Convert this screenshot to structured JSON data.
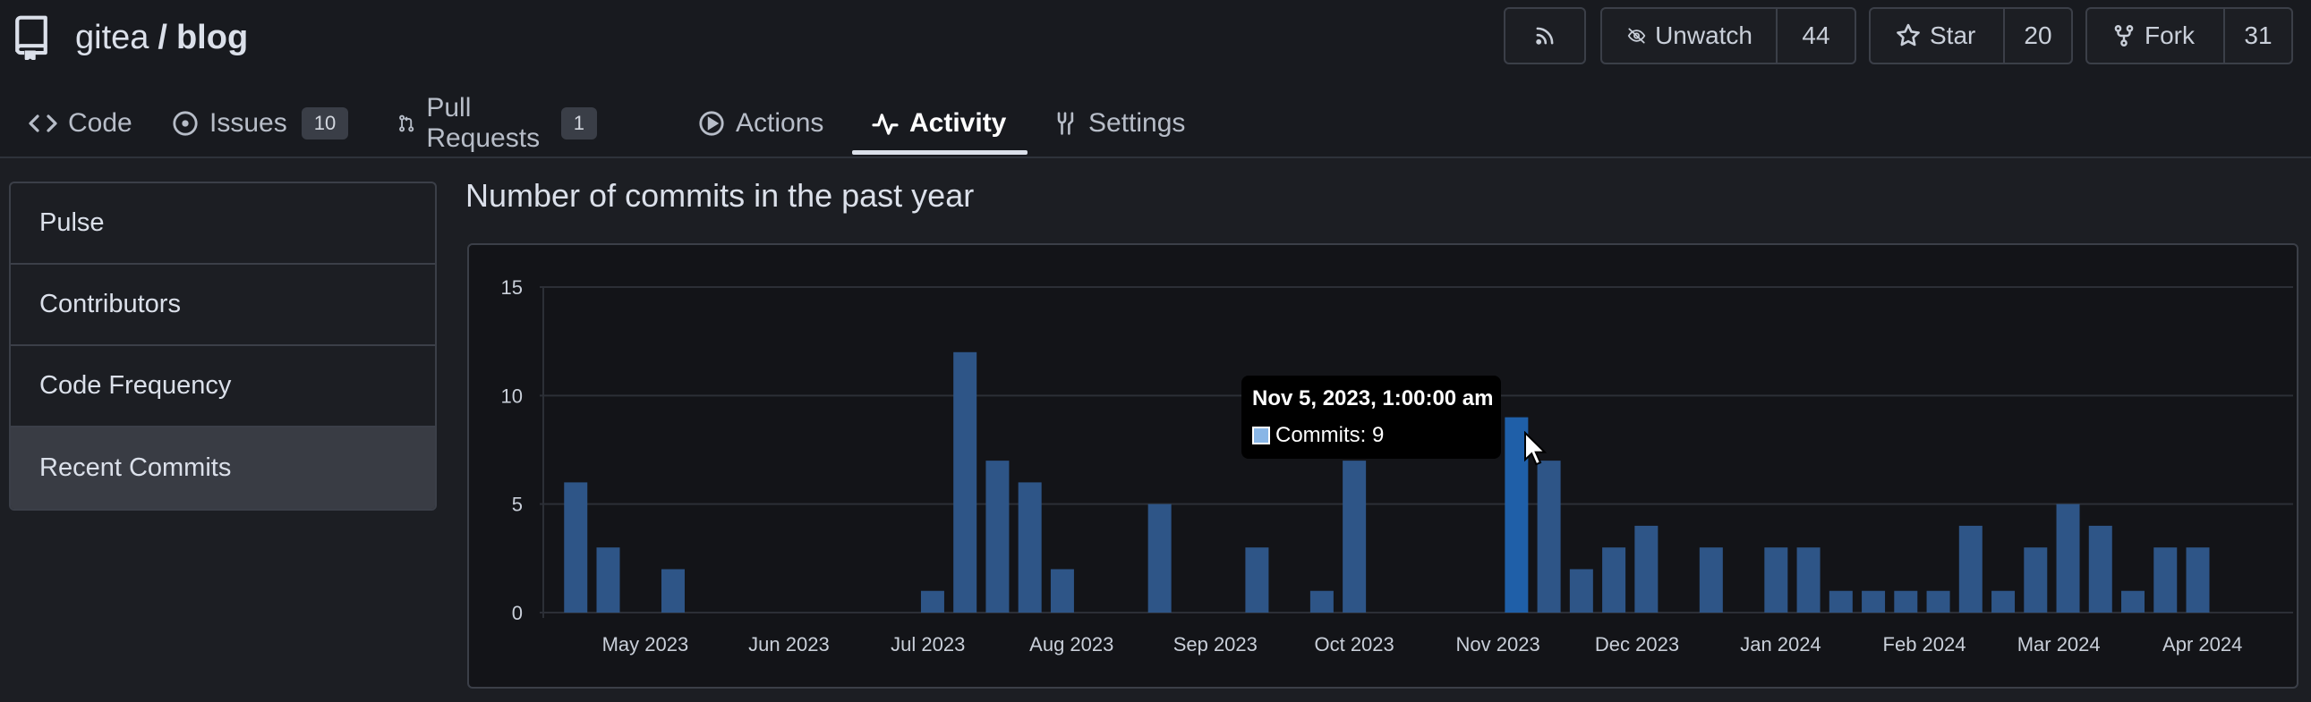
{
  "repo": {
    "owner": "gitea",
    "separator": "/",
    "name": "blog"
  },
  "actions": {
    "watch": {
      "label": "Unwatch",
      "count": "44"
    },
    "star": {
      "label": "Star",
      "count": "20"
    },
    "fork": {
      "label": "Fork",
      "count": "31"
    }
  },
  "tabs": [
    {
      "label": "Code",
      "icon": "code-icon"
    },
    {
      "label": "Issues",
      "icon": "issue-icon",
      "badge": "10"
    },
    {
      "label": "Pull Requests",
      "icon": "pull-request-icon",
      "badge": "1"
    },
    {
      "label": "Actions",
      "icon": "play-icon"
    },
    {
      "label": "Activity",
      "icon": "pulse-icon",
      "active": true
    },
    {
      "label": "Settings",
      "icon": "tools-icon"
    }
  ],
  "sidebar": {
    "items": [
      {
        "label": "Pulse"
      },
      {
        "label": "Contributors"
      },
      {
        "label": "Code Frequency"
      },
      {
        "label": "Recent Commits",
        "active": true
      }
    ]
  },
  "main": {
    "title": "Number of commits in the past year"
  },
  "colors": {
    "bar": "#2e5587",
    "bar_highlight": "#1f5fa8",
    "swatch": "#89b6e6"
  },
  "tooltip": {
    "title": "Nov 5, 2023, 1:00:00 am",
    "series": "Commits",
    "value": "9",
    "text": "Commits: 9"
  },
  "chart_data": {
    "type": "bar",
    "x_start": "2023-04-09",
    "x_end": "2024-04-14",
    "bar_interval": "week",
    "x": [
      "2023-04-16",
      "2023-04-23",
      "2023-04-30",
      "2023-05-07",
      "2023-05-14",
      "2023-05-21",
      "2023-05-28",
      "2023-06-04",
      "2023-06-11",
      "2023-06-18",
      "2023-06-25",
      "2023-07-02",
      "2023-07-09",
      "2023-07-16",
      "2023-07-23",
      "2023-07-30",
      "2023-08-06",
      "2023-08-13",
      "2023-08-20",
      "2023-08-27",
      "2023-09-03",
      "2023-09-10",
      "2023-09-17",
      "2023-09-24",
      "2023-10-01",
      "2023-10-08",
      "2023-10-15",
      "2023-10-22",
      "2023-10-29",
      "2023-11-05",
      "2023-11-12",
      "2023-11-19",
      "2023-11-26",
      "2023-12-03",
      "2023-12-10",
      "2023-12-17",
      "2023-12-24",
      "2023-12-31",
      "2024-01-07",
      "2024-01-14",
      "2024-01-21",
      "2024-01-28",
      "2024-02-04",
      "2024-02-11",
      "2024-02-18",
      "2024-02-25",
      "2024-03-03",
      "2024-03-10",
      "2024-03-17",
      "2024-03-24",
      "2024-03-31",
      "2024-04-07"
    ],
    "values": [
      6,
      3,
      0,
      2,
      0,
      0,
      0,
      0,
      0,
      0,
      0,
      1,
      12,
      7,
      6,
      2,
      0,
      0,
      5,
      0,
      0,
      3,
      0,
      1,
      7,
      0,
      0,
      0,
      0,
      9,
      7,
      2,
      3,
      4,
      0,
      3,
      0,
      3,
      3,
      1,
      1,
      1,
      1,
      4,
      1,
      3,
      5,
      4,
      1,
      3,
      3,
      0
    ],
    "highlight_index": 29,
    "y_ticks": [
      0,
      5,
      10,
      15
    ],
    "ylim": [
      0,
      15
    ],
    "x_ticks": [
      {
        "label": "May 2023",
        "date": "2023-05-01"
      },
      {
        "label": "Jun 2023",
        "date": "2023-06-01"
      },
      {
        "label": "Jul 2023",
        "date": "2023-07-01"
      },
      {
        "label": "Aug 2023",
        "date": "2023-08-01"
      },
      {
        "label": "Sep 2023",
        "date": "2023-09-01"
      },
      {
        "label": "Oct 2023",
        "date": "2023-10-01"
      },
      {
        "label": "Nov 2023",
        "date": "2023-11-01"
      },
      {
        "label": "Dec 2023",
        "date": "2023-12-01"
      },
      {
        "label": "Jan 2024",
        "date": "2024-01-01"
      },
      {
        "label": "Feb 2024",
        "date": "2024-02-01"
      },
      {
        "label": "Mar 2024",
        "date": "2024-03-01"
      },
      {
        "label": "Apr 2024",
        "date": "2024-04-01"
      }
    ],
    "grid": true,
    "legend": "none"
  }
}
